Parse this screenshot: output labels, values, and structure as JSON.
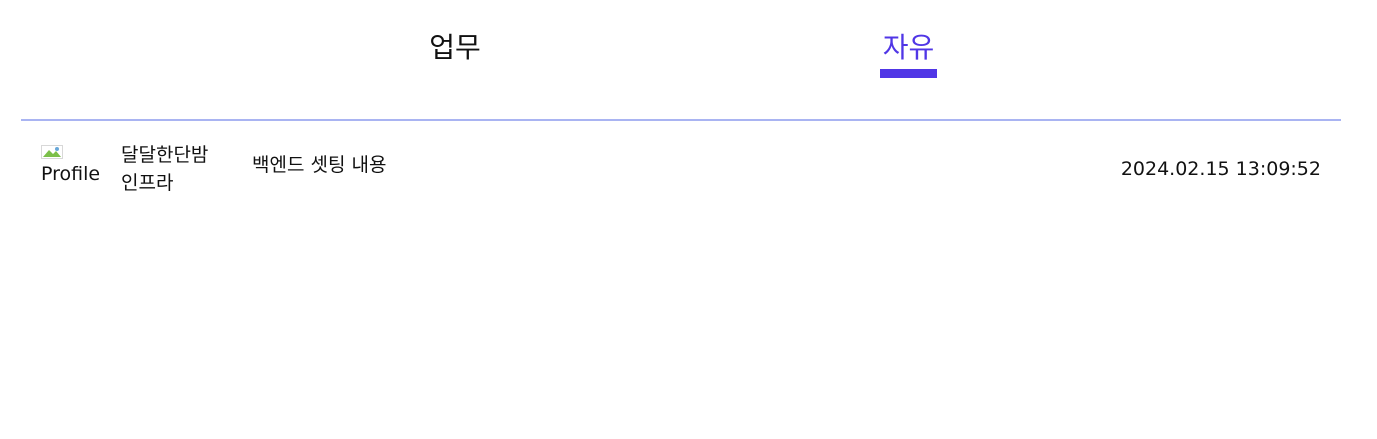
{
  "tabs": [
    {
      "label": "업무",
      "active": false
    },
    {
      "label": "자유",
      "active": true
    }
  ],
  "colors": {
    "accent": "#5036e6",
    "divider": "#a9b4f2",
    "text": "#111111"
  },
  "post": {
    "avatar_alt": "Profile",
    "author": "달달한단밤",
    "team": "인프라",
    "title": "백엔드 셋팅 내용",
    "date": "2024.02.15 13:09:52"
  }
}
